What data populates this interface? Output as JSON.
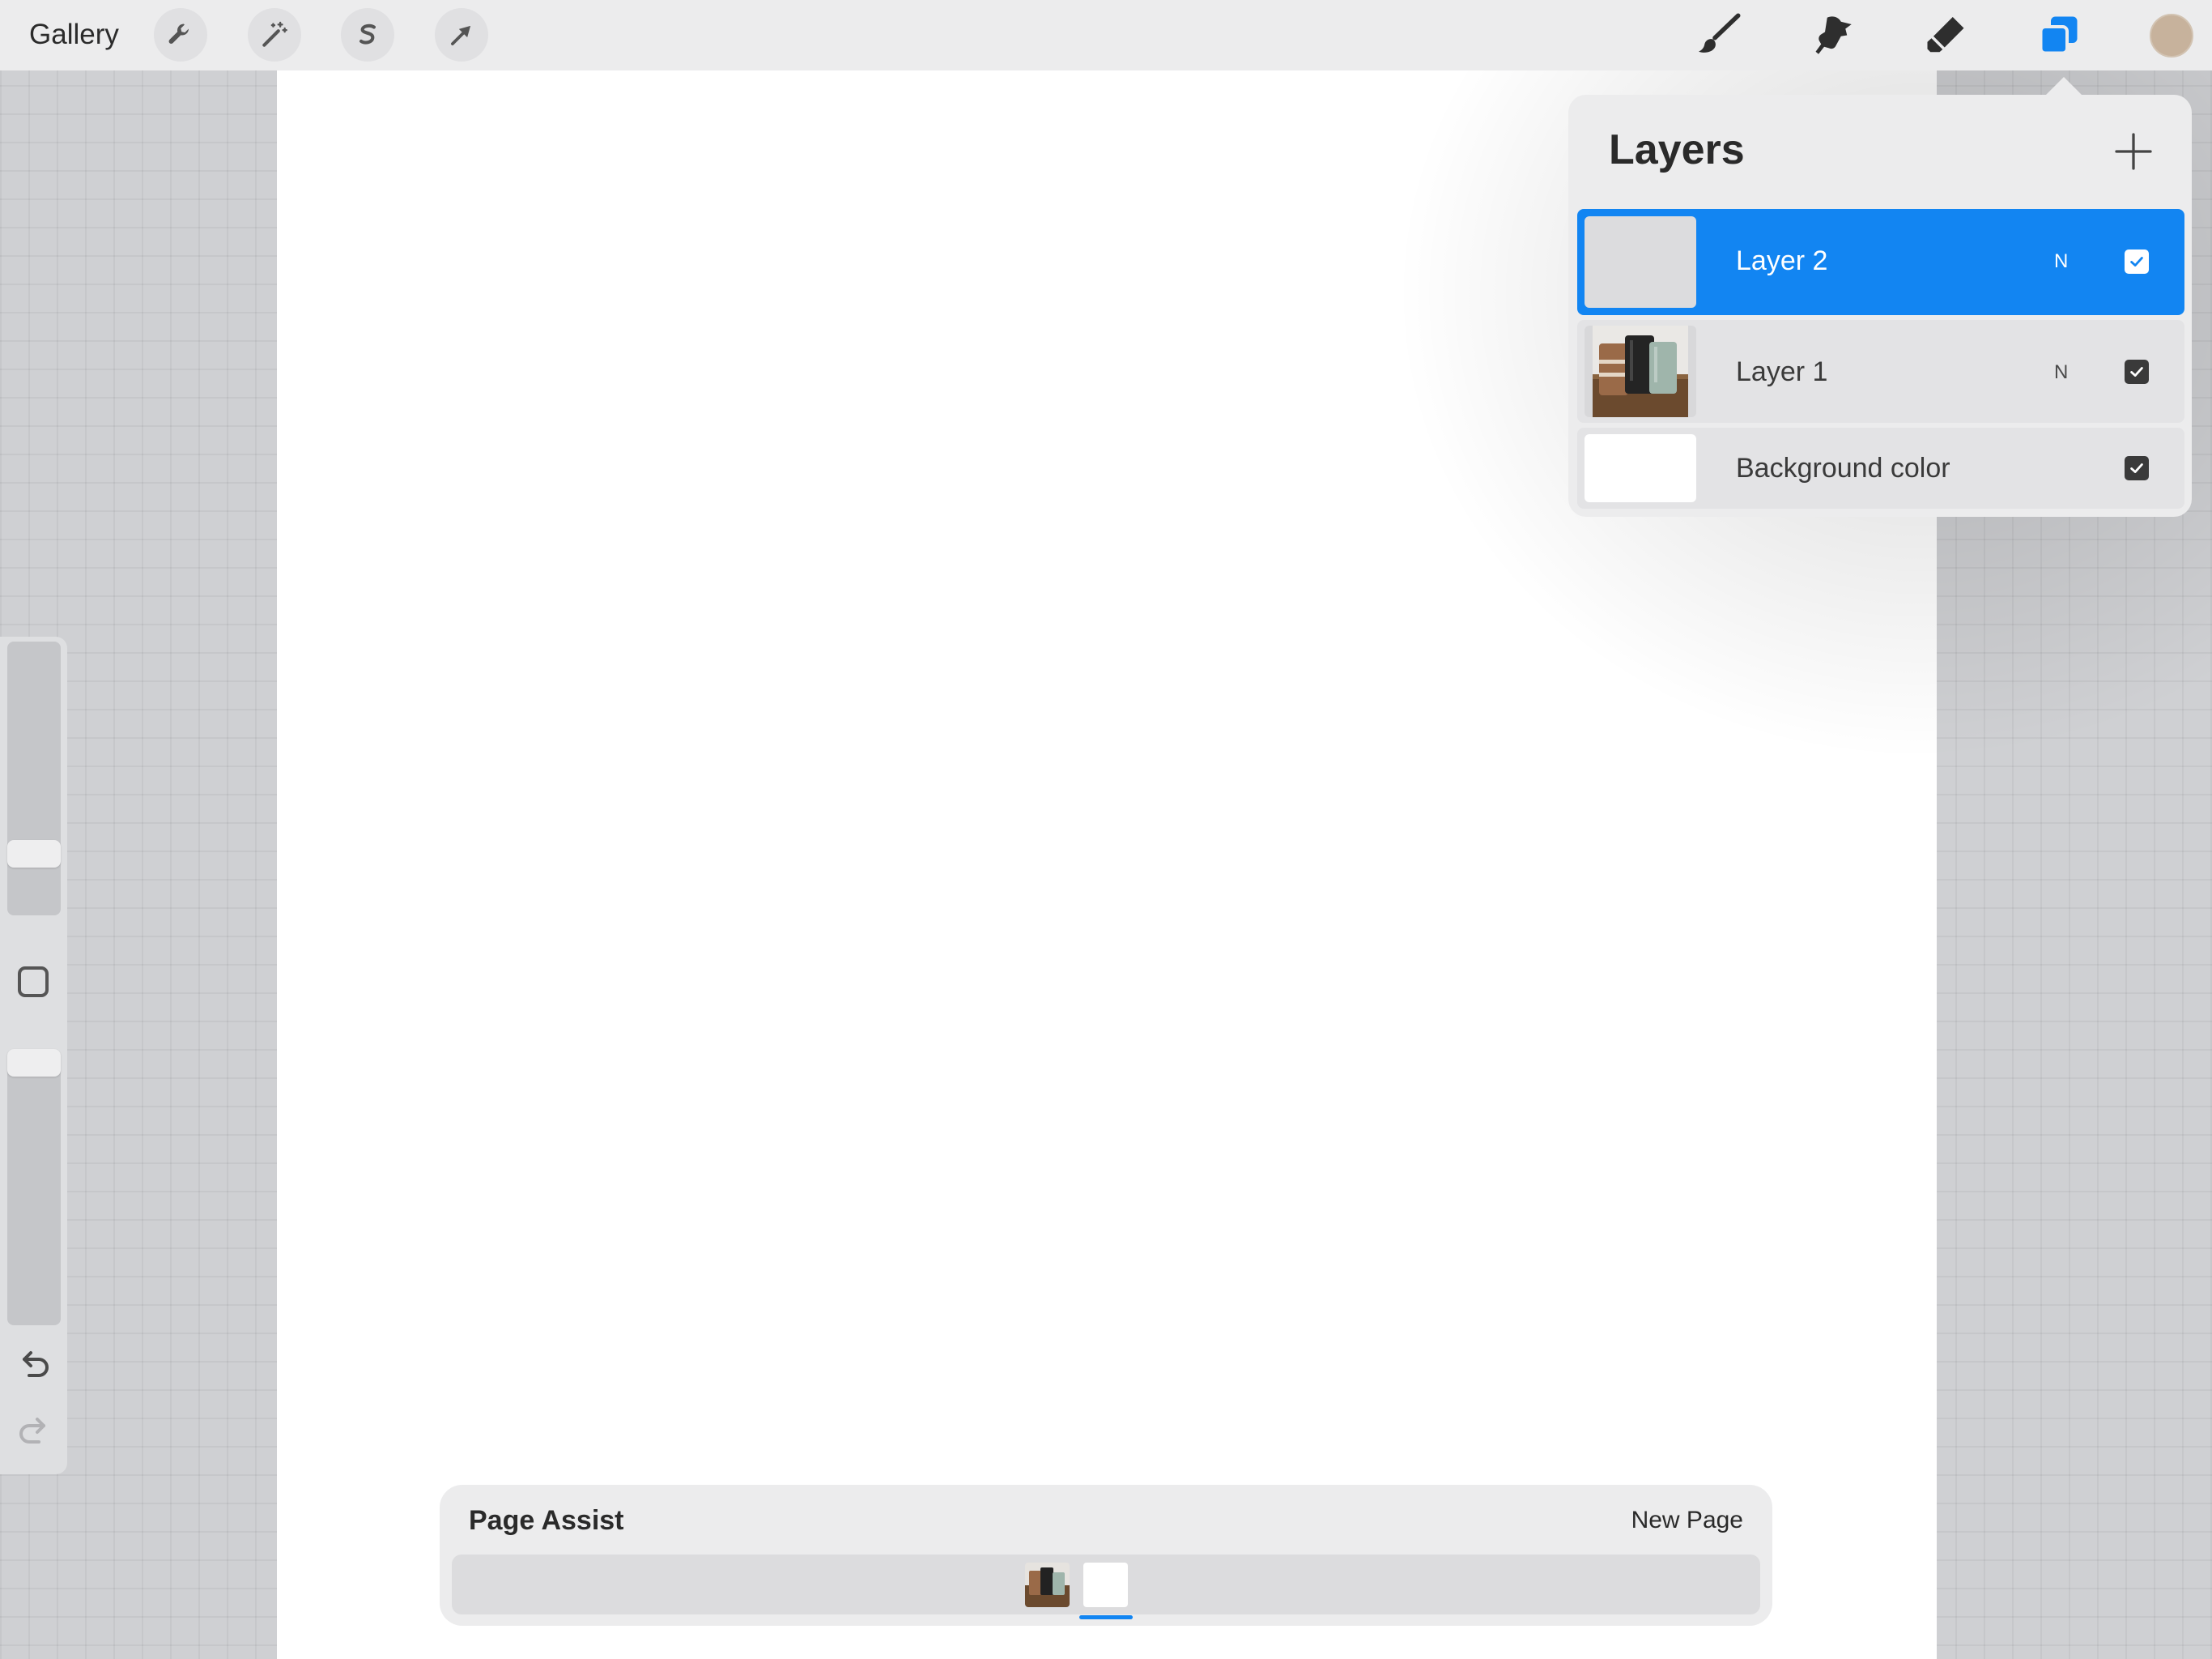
{
  "topbar": {
    "gallery_label": "Gallery",
    "left_tools": [
      "wrench-icon",
      "magic-wand-icon",
      "selection-icon",
      "transform-arrow-icon"
    ],
    "right_tools": [
      "brush-icon",
      "smudge-icon",
      "eraser-icon",
      "layers-icon"
    ],
    "active_tool": "layers-icon",
    "current_color": "#c7b29c"
  },
  "layers": {
    "title": "Layers",
    "add_icon": "plus-icon",
    "items": [
      {
        "name": "Layer 2",
        "blend": "N",
        "visible": true,
        "active": true
      },
      {
        "name": "Layer 1",
        "blend": "N",
        "visible": true,
        "active": false
      },
      {
        "name": "Background color",
        "blend": "",
        "visible": true,
        "active": false
      }
    ]
  },
  "sidebar": {
    "brush_size_icon": "slider",
    "opacity_icon": "slider",
    "modify_icon": "square-icon",
    "undo_icon": "undo-icon",
    "redo_icon": "redo-icon"
  },
  "page_assist": {
    "title": "Page Assist",
    "new_page_label": "New Page"
  },
  "colors": {
    "accent": "#1285f2",
    "toolbar_bg": "#ececed",
    "canvas_bg": "#ffffff"
  }
}
